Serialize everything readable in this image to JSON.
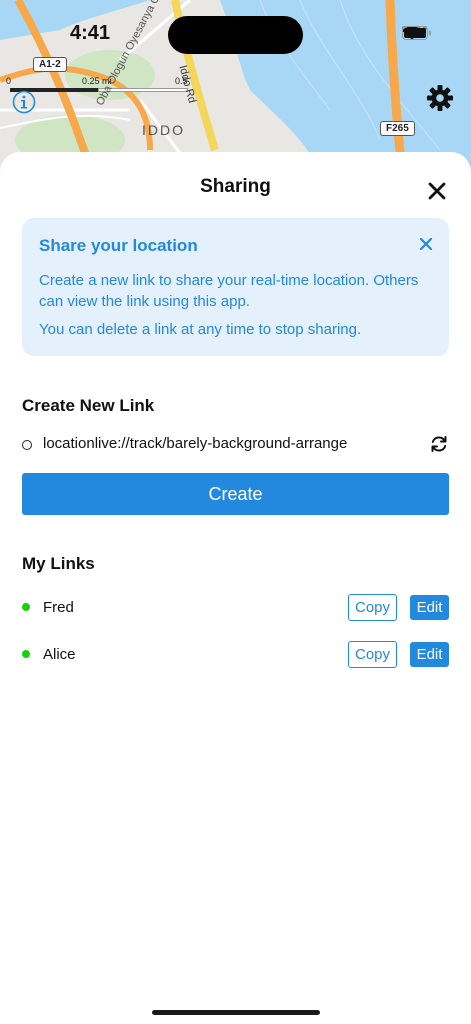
{
  "status_bar": {
    "time": "4:41",
    "icons": [
      "cellular-dots-icon",
      "wifi-icon",
      "battery-icon"
    ]
  },
  "map": {
    "scale": {
      "start": "0",
      "mid": "0.25 mi",
      "end": "0.5"
    },
    "labels": {
      "district": "IDDO",
      "street_1": "Oba Ologun Oyesanya Ganu Way",
      "street_2": "Iddo Rd"
    },
    "road_badges": [
      "A1-2",
      "F265"
    ],
    "icons": [
      "info-icon",
      "gear-icon"
    ]
  },
  "sheet": {
    "title": "Sharing",
    "banner": {
      "title": "Share your location",
      "paragraph_1": "Create a new link to share your real-time location. Others can view the link using this app.",
      "paragraph_2": "You can delete a link at any time to stop sharing."
    },
    "create_section": {
      "heading": "Create New Link",
      "link_url": "locationlive://track/barely-background-arrange",
      "create_label": "Create"
    },
    "my_links": {
      "heading": "My Links",
      "items": [
        {
          "name": "Fred",
          "copy_label": "Copy",
          "edit_label": "Edit",
          "status": "active"
        },
        {
          "name": "Alice",
          "copy_label": "Copy",
          "edit_label": "Edit",
          "status": "active"
        }
      ]
    }
  },
  "colors": {
    "accent": "#2389df",
    "banner_bg": "#e4f0fb",
    "status_active": "#18d10d",
    "map_water": "#a8d7f5",
    "map_land": "#e9e7e3",
    "map_road_major": "#f7a84b"
  }
}
